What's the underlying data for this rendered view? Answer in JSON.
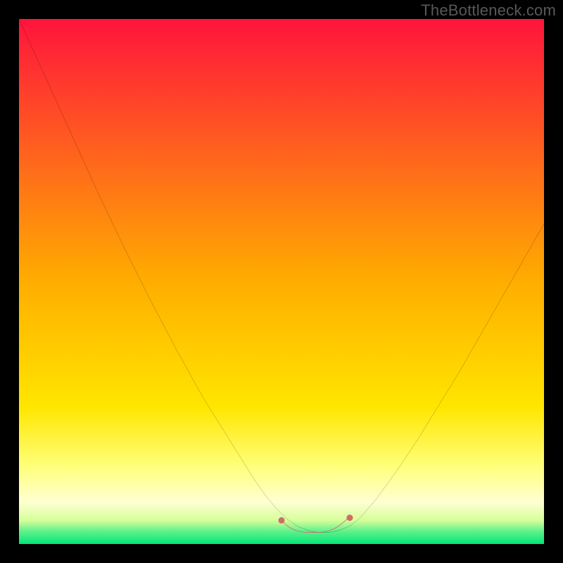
{
  "watermark": "TheBottleneck.com",
  "chart_data": {
    "type": "line",
    "title": "",
    "xlabel": "",
    "ylabel": "",
    "xlim": [
      0,
      100
    ],
    "ylim": [
      0,
      100
    ],
    "background_gradient": {
      "stops": [
        {
          "offset": 0.0,
          "color": "#ff143c"
        },
        {
          "offset": 0.5,
          "color": "#ffad00"
        },
        {
          "offset": 0.74,
          "color": "#ffe600"
        },
        {
          "offset": 0.85,
          "color": "#ffff78"
        },
        {
          "offset": 0.92,
          "color": "#ffffd2"
        },
        {
          "offset": 0.955,
          "color": "#d6ff9a"
        },
        {
          "offset": 0.975,
          "color": "#64f08c"
        },
        {
          "offset": 1.0,
          "color": "#00e878"
        }
      ]
    },
    "series": [
      {
        "name": "bottleneck-curve",
        "color": "#000000",
        "x": [
          0,
          5,
          10,
          15,
          20,
          25,
          30,
          35,
          40,
          45,
          47,
          49,
          51,
          53,
          55,
          57,
          59,
          61,
          63,
          65,
          68,
          72,
          76,
          80,
          84,
          88,
          92,
          96,
          100
        ],
        "y": [
          100,
          89,
          78,
          67,
          56.5,
          46.5,
          37,
          28,
          20,
          12,
          9.2,
          6.8,
          4.8,
          3.4,
          2.6,
          2.2,
          2.2,
          2.6,
          3.4,
          5.0,
          8.5,
          14,
          20,
          26.5,
          33,
          40,
          47,
          54,
          61
        ]
      },
      {
        "name": "optimal-zone-marker",
        "color": "#d46a6a",
        "stroke_width": 6,
        "x": [
          50,
          51,
          52,
          53,
          54,
          55,
          56,
          57,
          58,
          59,
          60,
          61,
          62,
          63
        ],
        "y": [
          4.5,
          3.5,
          2.9,
          2.5,
          2.3,
          2.2,
          2.2,
          2.2,
          2.3,
          2.5,
          2.9,
          3.5,
          4.3,
          5.2
        ]
      }
    ],
    "markers": [
      {
        "name": "dot-left",
        "x": 50,
        "y": 4.5,
        "r": 4.5,
        "color": "#d46a6a"
      },
      {
        "name": "dot-right",
        "x": 63,
        "y": 5.0,
        "r": 4.5,
        "color": "#d46a6a"
      }
    ]
  }
}
